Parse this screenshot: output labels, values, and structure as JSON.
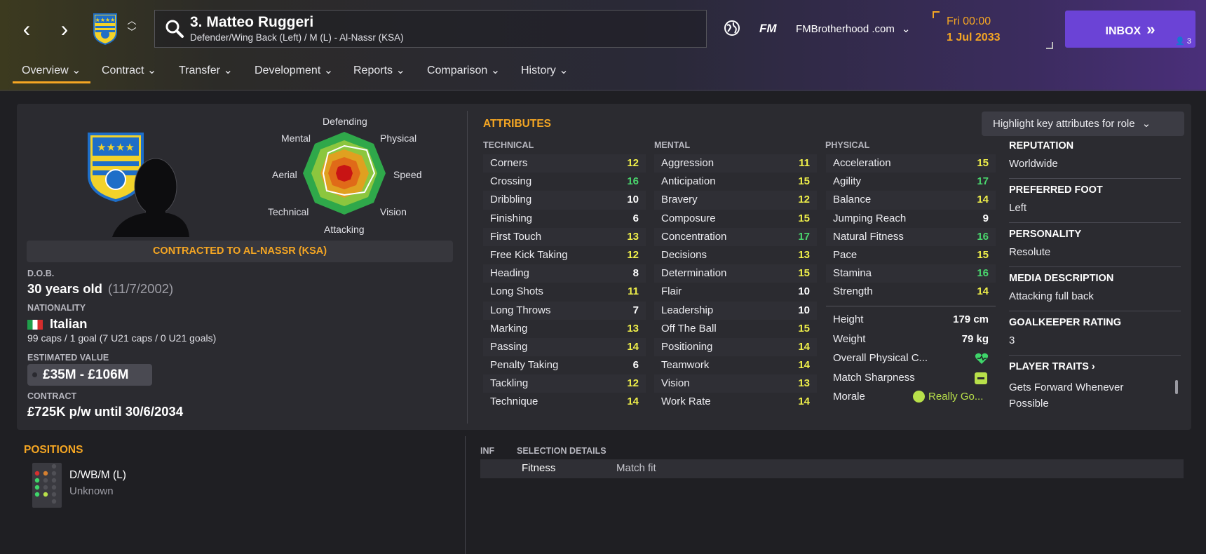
{
  "header": {
    "back_icon": "chevron-left-icon",
    "forward_icon": "chevron-right-icon",
    "player_title": "3. Matteo Ruggeri",
    "player_subtitle": "Defender/Wing Back (Left) / M (L) - Al-Nassr (KSA)",
    "fm_logo": "FM",
    "account": "FMBrotherhood .com",
    "day_time": "Fri 00:00",
    "date": "1 Jul 2033",
    "inbox_label": "INBOX",
    "inbox_count": "3"
  },
  "tabs": [
    {
      "label": "Overview"
    },
    {
      "label": "Contract"
    },
    {
      "label": "Transfer"
    },
    {
      "label": "Development"
    },
    {
      "label": "Reports"
    },
    {
      "label": "Comparison"
    },
    {
      "label": "History"
    }
  ],
  "radar": {
    "defending": "Defending",
    "physical": "Physical",
    "speed": "Speed",
    "vision": "Vision",
    "attacking": "Attacking",
    "technical": "Technical",
    "aerial": "Aerial",
    "mental": "Mental"
  },
  "profile": {
    "contract_banner": "CONTRACTED TO AL-NASSR (KSA)",
    "dob_label": "D.O.B.",
    "age": "30 years old",
    "dob": "(11/7/2002)",
    "nationality_label": "NATIONALITY",
    "nationality": "Italian",
    "caps": "99 caps / 1 goal (7 U21 caps / 0 U21 goals)",
    "value_label": "ESTIMATED VALUE",
    "value": "£35M - £106M",
    "contract_label": "CONTRACT",
    "contract": "£725K p/w until 30/6/2034"
  },
  "attributes": {
    "title": "ATTRIBUTES",
    "highlight_button": "Highlight key attributes for role",
    "technical_header": "TECHNICAL",
    "mental_header": "MENTAL",
    "physical_header": "PHYSICAL",
    "technical": [
      {
        "name": "Corners",
        "value": "12"
      },
      {
        "name": "Crossing",
        "value": "16"
      },
      {
        "name": "Dribbling",
        "value": "10"
      },
      {
        "name": "Finishing",
        "value": "6"
      },
      {
        "name": "First Touch",
        "value": "13"
      },
      {
        "name": "Free Kick Taking",
        "value": "12"
      },
      {
        "name": "Heading",
        "value": "8"
      },
      {
        "name": "Long Shots",
        "value": "11"
      },
      {
        "name": "Long Throws",
        "value": "7"
      },
      {
        "name": "Marking",
        "value": "13"
      },
      {
        "name": "Passing",
        "value": "14"
      },
      {
        "name": "Penalty Taking",
        "value": "6"
      },
      {
        "name": "Tackling",
        "value": "12"
      },
      {
        "name": "Technique",
        "value": "14"
      }
    ],
    "mental": [
      {
        "name": "Aggression",
        "value": "11"
      },
      {
        "name": "Anticipation",
        "value": "15"
      },
      {
        "name": "Bravery",
        "value": "12"
      },
      {
        "name": "Composure",
        "value": "15"
      },
      {
        "name": "Concentration",
        "value": "17"
      },
      {
        "name": "Decisions",
        "value": "13"
      },
      {
        "name": "Determination",
        "value": "15"
      },
      {
        "name": "Flair",
        "value": "10"
      },
      {
        "name": "Leadership",
        "value": "10"
      },
      {
        "name": "Off The Ball",
        "value": "15"
      },
      {
        "name": "Positioning",
        "value": "14"
      },
      {
        "name": "Teamwork",
        "value": "14"
      },
      {
        "name": "Vision",
        "value": "13"
      },
      {
        "name": "Work Rate",
        "value": "14"
      }
    ],
    "physical": [
      {
        "name": "Acceleration",
        "value": "15"
      },
      {
        "name": "Agility",
        "value": "17"
      },
      {
        "name": "Balance",
        "value": "14"
      },
      {
        "name": "Jumping Reach",
        "value": "9"
      },
      {
        "name": "Natural Fitness",
        "value": "16"
      },
      {
        "name": "Pace",
        "value": "15"
      },
      {
        "name": "Stamina",
        "value": "16"
      },
      {
        "name": "Strength",
        "value": "14"
      }
    ],
    "height_label": "Height",
    "height": "179 cm",
    "weight_label": "Weight",
    "weight": "79 kg",
    "condition_label": "Overall Physical C...",
    "sharpness_label": "Match Sharpness",
    "morale_label": "Morale",
    "morale": "Really Go..."
  },
  "info": {
    "reputation_label": "REPUTATION",
    "reputation": "Worldwide",
    "foot_label": "PREFERRED FOOT",
    "foot": "Left",
    "personality_label": "PERSONALITY",
    "personality": "Resolute",
    "media_label": "MEDIA DESCRIPTION",
    "media": "Attacking full back",
    "gk_label": "GOALKEEPER RATING",
    "gk": "3",
    "traits_label": "PLAYER TRAITS",
    "trait_1a": "Gets Forward Whenever",
    "trait_1b": "Possible"
  },
  "positions": {
    "title": "POSITIONS",
    "code": "D/WB/M (L)",
    "familiarity": "Unknown"
  },
  "selection": {
    "inf_header": "INF",
    "details_header": "SELECTION DETAILS",
    "fitness_label": "Fitness",
    "fitness_value": "Match fit"
  },
  "colors": {
    "accent": "#f5a623",
    "inbox": "#6b43d6",
    "good": "#4ad66d",
    "average": "#f0f04a"
  }
}
